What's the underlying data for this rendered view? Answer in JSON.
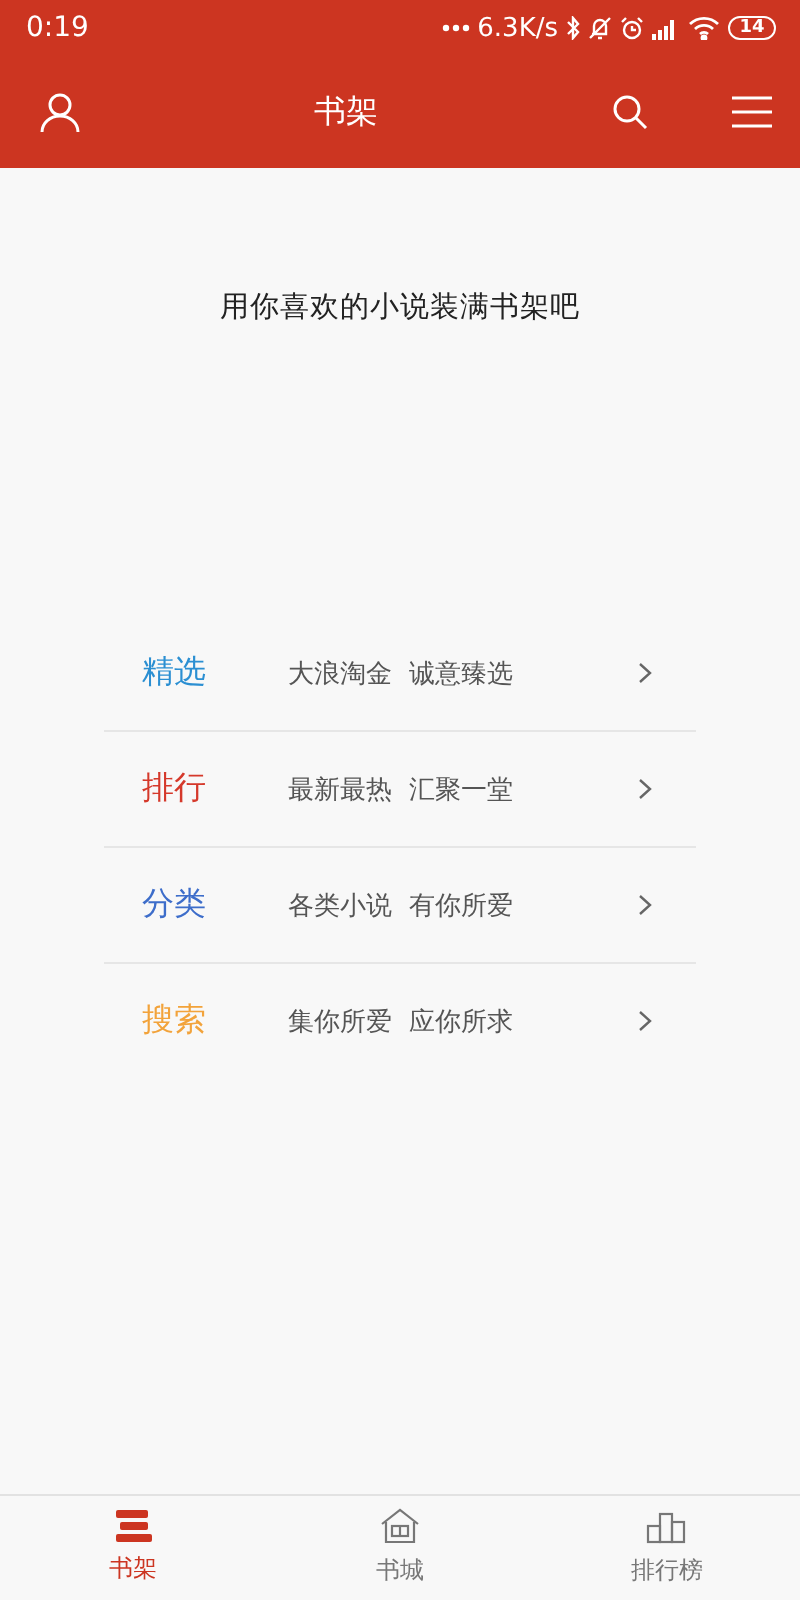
{
  "status_bar": {
    "time": "0:19",
    "speed": "6.3K/s",
    "battery": "14"
  },
  "header": {
    "title": "书架"
  },
  "empty_message": "用你喜欢的小说装满书架吧",
  "entries": [
    {
      "title": "精选",
      "subtitle": "大浪淘金  诚意臻选",
      "color": "#2b8fd2"
    },
    {
      "title": "排行",
      "subtitle": "最新最热  汇聚一堂",
      "color": "#d5392b"
    },
    {
      "title": "分类",
      "subtitle": "各类小说  有你所爱",
      "color": "#3d6dca"
    },
    {
      "title": "搜索",
      "subtitle": "集你所爱  应你所求",
      "color": "#f2a33b"
    }
  ],
  "tabs": [
    {
      "label": "书架",
      "kind": "shelf",
      "selected": true
    },
    {
      "label": "书城",
      "kind": "store",
      "selected": false
    },
    {
      "label": "排行榜",
      "kind": "rank",
      "selected": false
    }
  ]
}
